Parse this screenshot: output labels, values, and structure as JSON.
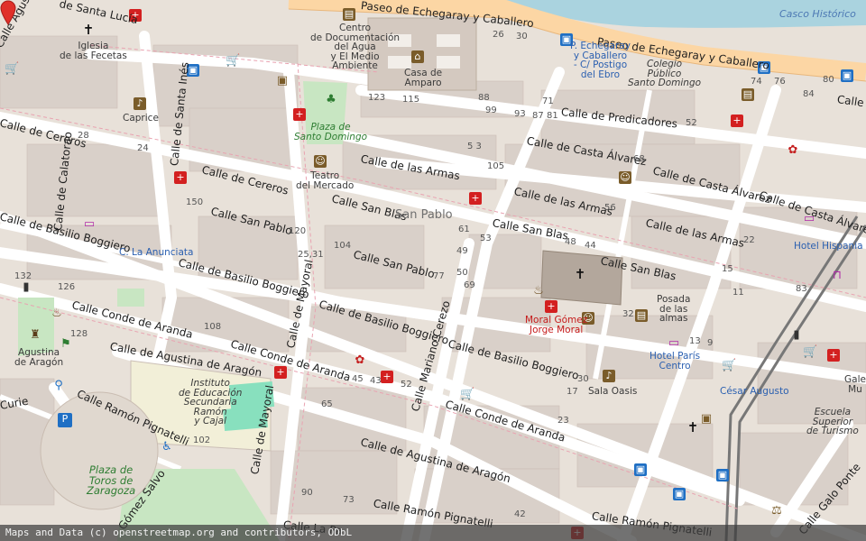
{
  "attribution": "Maps and Data (c) openstreetmap.org and contributors, ODbL",
  "marker": {
    "color": "#e0302a",
    "icon": "location-pin-icon"
  },
  "colors": {
    "background": "#e8e1d9",
    "building": "#d9d0c9",
    "river": "#aad3df",
    "main_road": "#fcd6a4",
    "park": "#c8e6c2",
    "pitch": "#88e0be"
  },
  "streets": {
    "echegaray_1": "Paseo de Echegaray y Caballero",
    "echegaray_2": "Paseo de Echegaray y Caballero",
    "santa_lucia": "de Santa Lucía",
    "aguila": "Calle Agustina",
    "cereros_1": "Calle de Cereros",
    "cereros_2": "Calle de Cereros",
    "calatorao": "Calle de Calatorao",
    "santa_ines": "Calle de Santa Inés",
    "basilio_1": "Calle de Basilio Boggiero",
    "basilio_2": "Calle de Basilio Boggiero",
    "basilio_3": "Calle de Basilio Boggiero",
    "basilio_4": "Calle de Basilio Boggiero",
    "san_pablo_1": "Calle San Pablo",
    "san_pablo_2": "Calle San Pablo",
    "san_blas_1": "Calle San Blas",
    "san_blas_2": "Calle San Blas",
    "san_blas_3": "Calle San Blas",
    "predicadores": "Calle de Predicadores",
    "casta_1": "Calle de Casta Álvarez",
    "casta_2": "Calle de Casta Álvarez",
    "casta_3": "Calle de Casta Álvarez",
    "armas_1": "Calle de las Armas",
    "armas_2": "Calle de las Armas",
    "armas_3": "Calle de las Armas",
    "conde_1": "Calle Conde de Aranda",
    "conde_2": "Calle Conde de Aranda",
    "conde_3": "Calle Conde de Aranda",
    "agustina_1": "Calle de Agustina de Aragón",
    "agustina_2": "Calle de Agustina de Aragón",
    "ramon_1": "Calle Ramón Pignatelli",
    "ramon_2": "Calle Ramón Pignatelli",
    "ramon_3": "Calle Ramón Pignatelli",
    "mayoral_1": "Calle de Mayoral",
    "mayoral_2": "Calle de Mayoral",
    "mariano": "Calle Mariano Cerezo",
    "gomez": "Gómez Salvo",
    "galo": "Calle Galo Ponte",
    "curie": "Curie",
    "la_pa": "Calle La Pa",
    "este": "Calle Es"
  },
  "places": {
    "iglesia_fecetas": "Iglesia\nde las Fecetas",
    "centro_agua": "Centro\nde Documentación\ndel Agua\ny El Medio\nAmbiente",
    "casa_amparo": "Casa de\nAmparo",
    "caprice": "Caprice",
    "plaza_sto_domingo": "Plaza de\nSanto Domingo",
    "teatro_mercado": "Teatro\ndel Mercado",
    "san_pablo": "San Pablo",
    "la_anunciata": "C. La Anunciata",
    "colegio_sto_domingo": "Colegio\nPúblico\nSanto Domingo",
    "parada_echegaray": "P. Echegaray\ny Caballero\n- C/ Postigo\ndel Ebro",
    "casco_historico": "Casco Histórico",
    "hotel_hispania": "Hotel Hispania",
    "posada_almas": "Posada\nde las\nalmas",
    "moral_gomez": "Moral Gómez\nJorge Moral",
    "hotel_paris": "Hotel París\nCentro",
    "cesar_augusto": "César Augusto",
    "sala_oasis": "Sala Oasis",
    "escuela_turismo": "Escuela\nSuperior\nde Turismo",
    "gale": "Gale\nMu",
    "instituto": "Instituto\nde Educación\nSecundaria\nRamón\ny Cajal",
    "agustina_aragon": "Agustina\nde Aragón",
    "plaza_toros": "Plaza de\nToros de\nZaragoza"
  },
  "house_numbers": {
    "n26": "26",
    "n30": "30",
    "n88": "88",
    "n123": "123",
    "n115": "115",
    "n99": "99",
    "n93": "93",
    "n87": "87",
    "n81": "81",
    "n71": "71",
    "n52": "52",
    "n28": "28",
    "n24": "24",
    "n150": "150",
    "n120": "120",
    "n104": "104",
    "n25_31": "25,31",
    "n132": "132",
    "n126": "126",
    "n108": "108",
    "n128": "128",
    "n45": "45",
    "n43": "43",
    "n52b": "52",
    "n69": "69",
    "n77": "77",
    "n49": "49",
    "n50": "50",
    "n53": "53",
    "n61": "61",
    "n105": "105",
    "n68": "68",
    "n56": "56",
    "n48": "48",
    "n44": "44",
    "n32": "32",
    "n22": "22",
    "n15": "15",
    "n11": "11",
    "n13": "13",
    "n9": "9",
    "n30b": "30",
    "n17": "17",
    "n23": "23",
    "n102": "102",
    "n90": "90",
    "n73": "73",
    "n80": "80",
    "n76": "76",
    "n83": "83",
    "n84": "84",
    "n74": "74",
    "n5_3": "5 3",
    "n65": "65",
    "n42": "42"
  }
}
